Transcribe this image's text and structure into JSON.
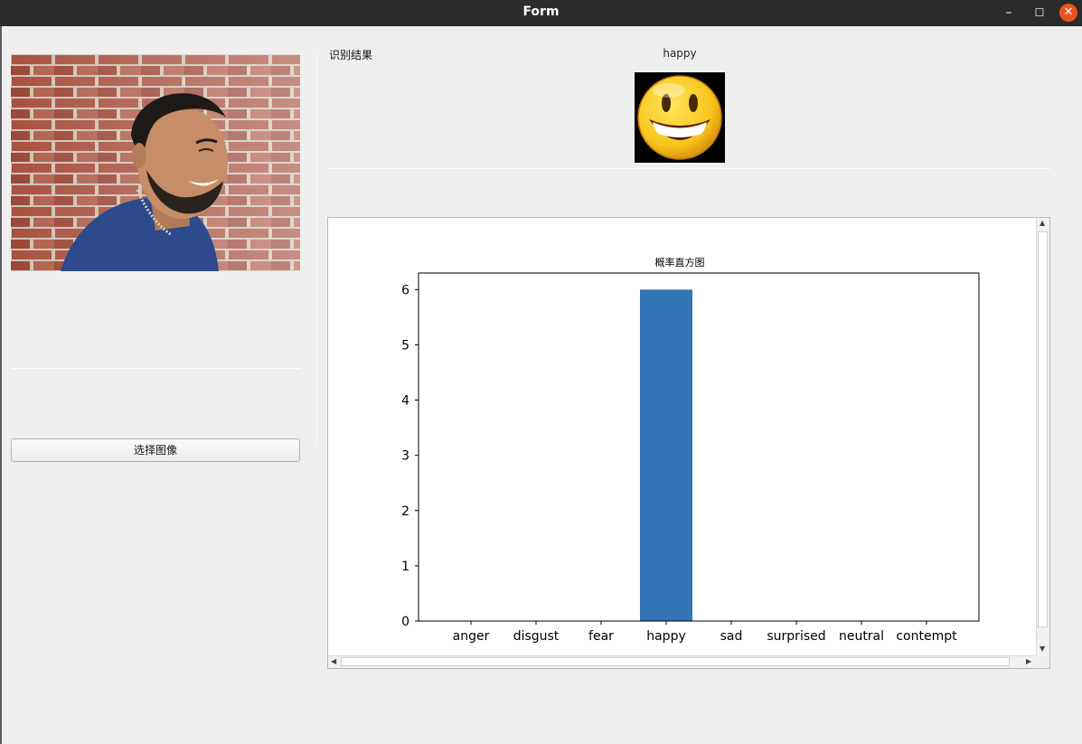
{
  "window": {
    "title": "Form",
    "controls": {
      "minimize": "–",
      "maximize": "☐",
      "close": "✕"
    }
  },
  "left_panel": {
    "photo_alt": "smiling man against brick wall",
    "select_button_label": "选择图像"
  },
  "right_panel": {
    "result_label": "识别结果",
    "emotion_name": "happy",
    "emoji": "smiling-face"
  },
  "chart_data": {
    "type": "bar",
    "title": "概率直方图",
    "categories": [
      "anger",
      "disgust",
      "fear",
      "happy",
      "sad",
      "surprised",
      "neutral",
      "contempt"
    ],
    "values": [
      0,
      0,
      0,
      6,
      0,
      0,
      0,
      0
    ],
    "ylim": [
      0,
      6.3
    ],
    "yticks": [
      0,
      1,
      2,
      3,
      4,
      5,
      6
    ],
    "bar_color": "#3274b5",
    "grid": false
  },
  "colors": {
    "titlebar": "#2b2b2b",
    "close_button": "#e95420",
    "background": "#efefef"
  }
}
